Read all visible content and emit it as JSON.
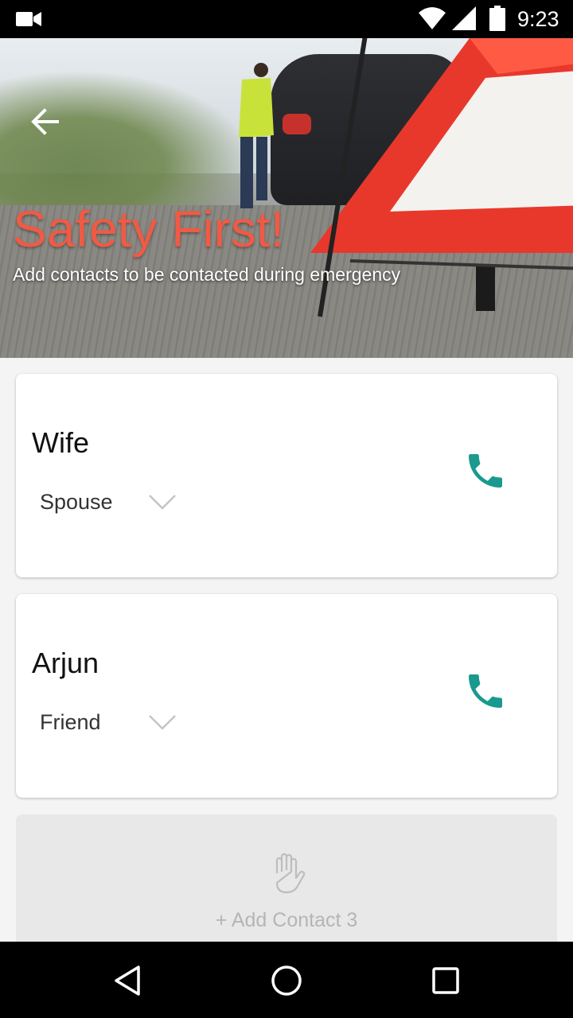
{
  "status_bar": {
    "time": "9:23",
    "icons": [
      "video-icon",
      "wifi-icon",
      "signal-icon",
      "battery-icon"
    ]
  },
  "header": {
    "back_icon": "arrow-left-icon",
    "title": "Safety First!",
    "subtitle": "Add contacts to be contacted during emergency"
  },
  "contacts": [
    {
      "name": "Wife",
      "relation": "Spouse",
      "call_icon": "phone-icon"
    },
    {
      "name": "Arjun",
      "relation": "Friend",
      "call_icon": "phone-icon"
    }
  ],
  "add_contact": {
    "icon": "hand-icon",
    "label": "+ Add Contact 3"
  },
  "nav_bar": {
    "buttons": [
      "back-triangle-icon",
      "home-circle-icon",
      "recents-square-icon"
    ]
  },
  "colors": {
    "accent_title": "#f05a44",
    "call_icon": "#1a9a8e",
    "add_card_bg": "#e8e8e8"
  }
}
